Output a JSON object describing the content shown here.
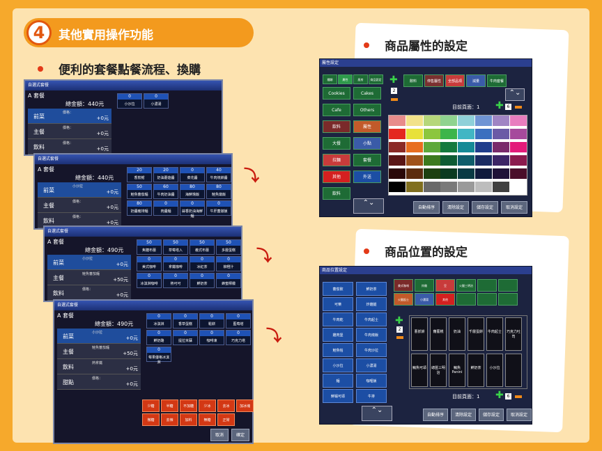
{
  "section_number": "4",
  "section_title": "其他實用操作功能",
  "left_heading": "便利的套餐點餐流程、換購",
  "right_heading_1": "商品屬性的設定",
  "right_heading_2": "商品位置的設定",
  "set_window": {
    "title": "自選式套餐",
    "screens": [
      {
        "name": "A 套餐",
        "total": "總金額：440元",
        "cats": [
          {
            "label": "前菜",
            "sub": "價格：",
            "val": "+0元"
          },
          {
            "label": "主餐",
            "sub": "價格：",
            "val": "+0元"
          },
          {
            "label": "飲料",
            "sub": "價格：",
            "val": "+0元"
          }
        ],
        "items": [
          {
            "p": "0",
            "n": "小沙拉"
          },
          {
            "p": "0",
            "n": "小濃湯"
          }
        ]
      },
      {
        "name": "A 套餐",
        "total": "總金額：440元",
        "cats": [
          {
            "label": "前菜",
            "sub": "小沙拉",
            "val": "+0元"
          },
          {
            "label": "主餐",
            "sub": "價格：",
            "val": "+0元"
          },
          {
            "label": "飲料",
            "sub": "價格：",
            "val": "+0元"
          }
        ],
        "items": [
          {
            "p": "20",
            "n": "香煎鱈"
          },
          {
            "p": "20",
            "n": "奶油蘑菇醬"
          },
          {
            "p": "0",
            "n": "菜花醬"
          },
          {
            "p": "40",
            "n": "牛肉燒餅醬"
          },
          {
            "p": "50",
            "n": "鮭魚蕃茄麵"
          },
          {
            "p": "60",
            "n": "牛肉奶油醬"
          },
          {
            "p": "80",
            "n": "海鮮燴飯"
          },
          {
            "p": "80",
            "n": "鮭魚燉飯"
          },
          {
            "p": "80",
            "n": "奶醬豬排麵"
          },
          {
            "p": "0",
            "n": "肉醬麵"
          },
          {
            "p": "0",
            "n": "蒜香奶油海鮮麵"
          },
          {
            "p": "0",
            "n": "牛肝菌燉飯"
          }
        ]
      },
      {
        "name": "A 套餐",
        "total": "總金額：490元",
        "cats": [
          {
            "label": "前菜",
            "sub": "小沙拉",
            "val": "+0元"
          },
          {
            "label": "主餐",
            "sub": "鮭魚蕃茄麵",
            "val": "+50元"
          },
          {
            "label": "飲料",
            "sub": "價格：",
            "val": "+0元"
          }
        ],
        "items": [
          {
            "p": "50",
            "n": "焦糖布蕾"
          },
          {
            "p": "50",
            "n": "草莓塔入"
          },
          {
            "p": "50",
            "n": "義式布蕾"
          },
          {
            "p": "50",
            "n": "多層蛋糕"
          },
          {
            "p": "0",
            "n": "美式咖啡"
          },
          {
            "p": "0",
            "n": "拿鐵咖啡"
          },
          {
            "p": "0",
            "n": "冰紅茶"
          },
          {
            "p": "0",
            "n": "柳橙汁"
          },
          {
            "p": "0",
            "n": "冰淇淋咖啡"
          },
          {
            "p": "0",
            "n": "熱可可"
          },
          {
            "p": "0",
            "n": "鮮奶茶"
          },
          {
            "p": "0",
            "n": "蜂蜜檸檬"
          }
        ]
      },
      {
        "name": "A 套餐",
        "total": "總金額：490元",
        "cats": [
          {
            "label": "前菜",
            "sub": "小沙拉",
            "val": "+0元"
          },
          {
            "label": "主餐",
            "sub": "鮭魚蕃茄麵",
            "val": "+50元"
          },
          {
            "label": "飲料",
            "sub": "熱拿鐵",
            "val": "+0元"
          },
          {
            "label": "甜點",
            "sub": "價格：",
            "val": "+0元"
          }
        ],
        "items": [
          {
            "p": "0",
            "n": "冰淇淋"
          },
          {
            "p": "0",
            "n": "香草蛋糕"
          },
          {
            "p": "0",
            "n": "鬆餅"
          },
          {
            "p": "0",
            "n": "藍莓塔"
          },
          {
            "p": "0",
            "n": "鮮奶酪"
          },
          {
            "p": "0",
            "n": "提拉米蘇"
          },
          {
            "p": "0",
            "n": "咖啡凍"
          },
          {
            "p": "0",
            "n": "巧克力塔"
          },
          {
            "p": "0",
            "n": "莓果優格冰淇淋"
          }
        ],
        "red": [
          "少糖",
          "半糖",
          "不加糖",
          "少冰",
          "去冰",
          "加冰塊",
          "微糖",
          "去辣",
          "加料",
          "無糖",
          "正常"
        ],
        "cancel": "取消",
        "confirm": "確定"
      }
    ]
  },
  "attr_window": {
    "title": "屬性設定",
    "tabs": [
      "種類",
      "屬性",
      "廚房",
      "商品設定"
    ],
    "cats": [
      "Cookies",
      "Cakes",
      "Cafe",
      "Others",
      "飲料",
      "屬性",
      "大餐",
      "小點",
      "拉麵",
      "套餐",
      "其他",
      "外送",
      "飲料"
    ],
    "attrs": [
      "飲料",
      "停售屬性",
      "全部品項",
      "減量",
      "牛肉套餐"
    ],
    "page_label": "目前頁面：1",
    "page_count": "6",
    "buttons": [
      "自動排序",
      "清除設定",
      "儲存設定",
      "取消設定"
    ],
    "palette": [
      "#e88c8b",
      "#f2e28a",
      "#b6d77a",
      "#8fd38f",
      "#8fd0d9",
      "#6f94d4",
      "#a084c4",
      "#e87dbf",
      "#e4271f",
      "#e8e13a",
      "#8cc63e",
      "#3cb54a",
      "#41b6c4",
      "#3b6fbf",
      "#6b5aa6",
      "#a64a9c",
      "#8b2a26",
      "#e86e1f",
      "#5da83a",
      "#147a3e",
      "#148a96",
      "#1f3d8c",
      "#7a2a6b",
      "#e31b7a",
      "#5a1616",
      "#a0521a",
      "#3c7a1e",
      "#0e5c34",
      "#0e5d6b",
      "#1a2b62",
      "#3d2566",
      "#8b1a4d",
      "#2a0808",
      "#5c2c0e",
      "#1e4010",
      "#0a3a20",
      "#0a3a44",
      "#101a3c",
      "#1f1238",
      "#4a0e2a",
      "#000000",
      "#806f1f",
      "#696969",
      "#7a7a7a",
      "#9a9a9a",
      "#bdbdbd",
      "#404040",
      "#ffffff"
    ]
  },
  "pos_window": {
    "title": "商品位置設定",
    "left_items": [
      "蕃茄飲",
      "鮮奶茶",
      "可樂",
      "炸雞腿",
      "牛肉乾",
      "牛肉起士",
      "雞肉堡",
      "牛肉燒飯",
      "鮭魚帕",
      "牛肉沙拉",
      "小沙拉",
      "小濃湯",
      "麵",
      "咖哩飯",
      "鮮蝦可頌",
      "牛排"
    ],
    "page_label": "目前頁面：1",
    "page_count": "6",
    "buttons": [
      "自動排序",
      "清除設定",
      "儲存設定",
      "取消設定"
    ]
  }
}
